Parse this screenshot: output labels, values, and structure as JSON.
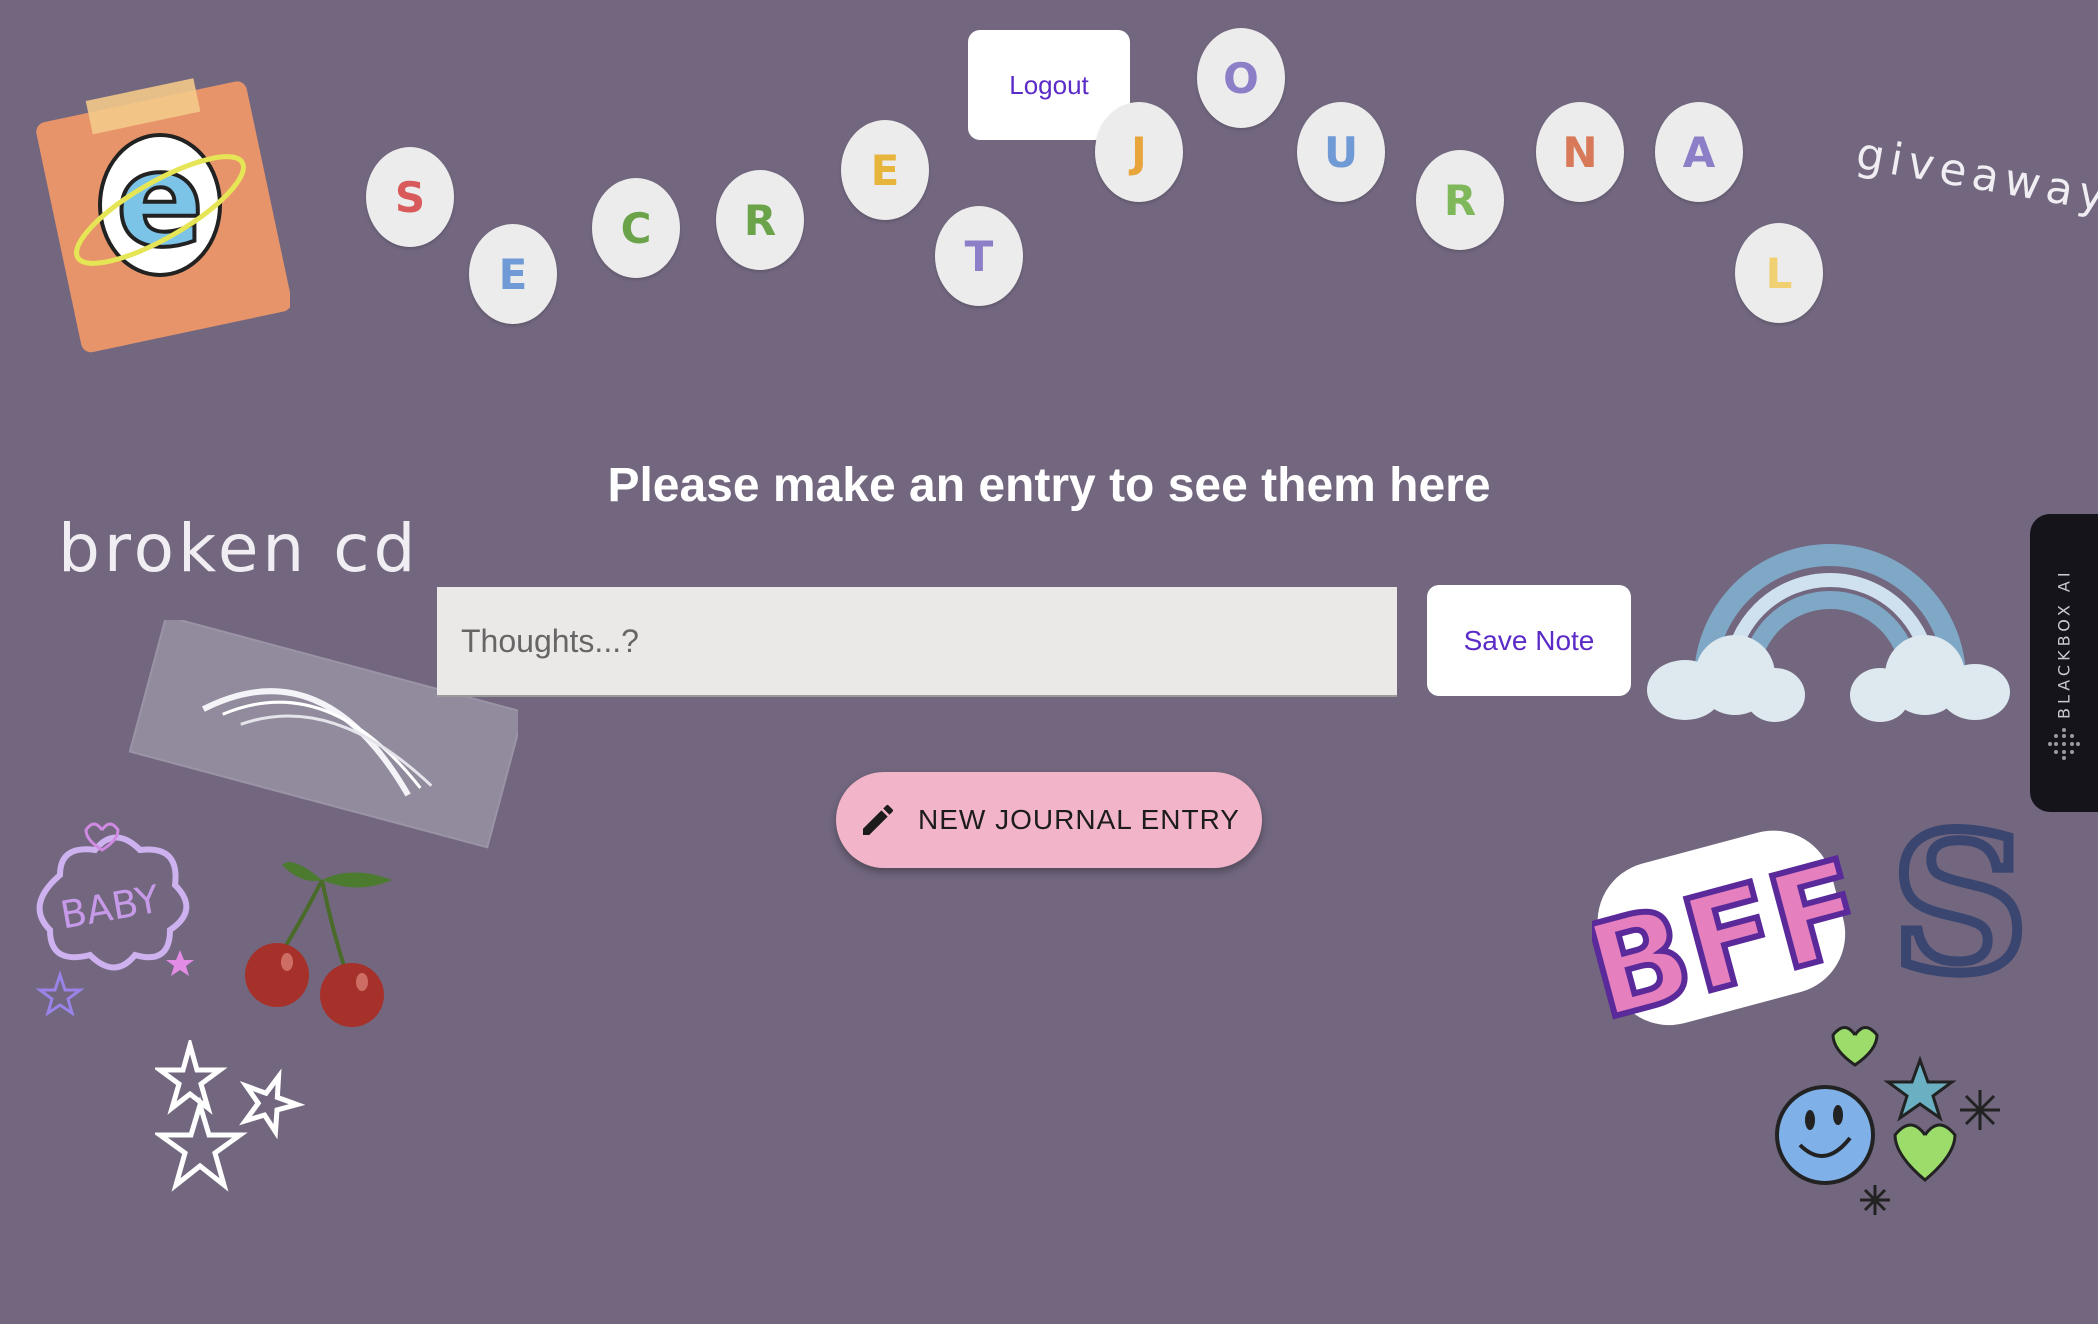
{
  "header": {
    "logout_label": "Logout",
    "title_letters": [
      {
        "char": "S",
        "color": "#d85a5a"
      },
      {
        "char": "E",
        "color": "#6f9ad6"
      },
      {
        "char": "C",
        "color": "#6aa34a"
      },
      {
        "char": "R",
        "color": "#6aa34a"
      },
      {
        "char": "E",
        "color": "#e8b53c"
      },
      {
        "char": "T",
        "color": "#8c7fc7"
      },
      {
        "char": "J",
        "color": "#e8a53c"
      },
      {
        "char": "O",
        "color": "#8c7fc7"
      },
      {
        "char": "U",
        "color": "#6f9ad6"
      },
      {
        "char": "R",
        "color": "#7fb85a"
      },
      {
        "char": "N",
        "color": "#d87a5a"
      },
      {
        "char": "A",
        "color": "#8c7fc7"
      },
      {
        "char": "L",
        "color": "#f0d070"
      }
    ]
  },
  "main": {
    "empty_message": "Please make an entry to see them here",
    "note_input": {
      "value": "",
      "placeholder": "Thoughts...?"
    },
    "save_label": "Save Note",
    "new_entry_label": "NEW JOURNAL ENTRY",
    "new_entry_icon": "pencil-icon"
  },
  "stickers": {
    "giveaway": "giveaway",
    "broken_cd": "broken cd",
    "baby": "BABY",
    "bff": "BFF",
    "s_letter": "S"
  },
  "sidebar_widget": {
    "label": "BLACKBOX AI"
  }
}
